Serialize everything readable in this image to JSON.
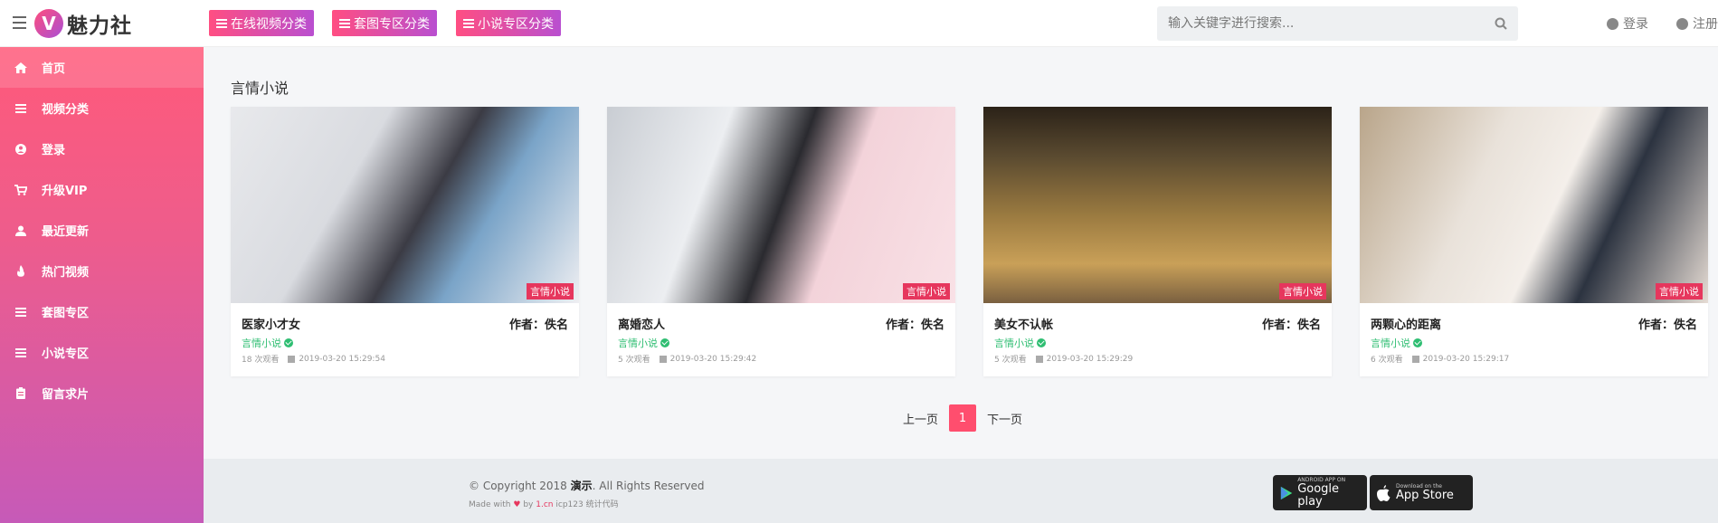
{
  "header": {
    "logo_letter": "V",
    "logo_text": "魅力社",
    "categories": [
      {
        "label": "在线视频分类"
      },
      {
        "label": "套图专区分类"
      },
      {
        "label": "小说专区分类"
      }
    ],
    "search_placeholder": "输入关键字进行搜索...",
    "login_label": "登录",
    "register_label": "注册"
  },
  "sidebar": {
    "items": [
      {
        "label": "首页",
        "icon": "home-icon"
      },
      {
        "label": "视频分类",
        "icon": "list-icon"
      },
      {
        "label": "登录",
        "icon": "user-circle-icon"
      },
      {
        "label": "升级VIP",
        "icon": "cart-icon"
      },
      {
        "label": "最近更新",
        "icon": "user-icon"
      },
      {
        "label": "热门视频",
        "icon": "fire-icon"
      },
      {
        "label": "套图专区",
        "icon": "list-icon"
      },
      {
        "label": "小说专区",
        "icon": "list-icon"
      },
      {
        "label": "留言求片",
        "icon": "clipboard-icon"
      }
    ]
  },
  "section": {
    "title": "言情小说"
  },
  "cards": [
    {
      "title": "医家小才女",
      "author": "作者：佚名",
      "category": "言情小说",
      "tag": "言情小说",
      "views": "18 次观看",
      "date": "2019-03-20 15:29:54"
    },
    {
      "title": "离婚恋人",
      "author": "作者：佚名",
      "category": "言情小说",
      "tag": "言情小说",
      "views": "5 次观看",
      "date": "2019-03-20 15:29:42"
    },
    {
      "title": "美女不认帐",
      "author": "作者：佚名",
      "category": "言情小说",
      "tag": "言情小说",
      "views": "5 次观看",
      "date": "2019-03-20 15:29:29"
    },
    {
      "title": "两颗心的距离",
      "author": "作者：佚名",
      "category": "言情小说",
      "tag": "言情小说",
      "views": "6 次观看",
      "date": "2019-03-20 15:29:17"
    }
  ],
  "pagination": {
    "prev": "上一页",
    "current": "1",
    "next": "下一页"
  },
  "footer": {
    "copyright_prefix": "© Copyright 2018",
    "copyright_site": "演示",
    "copyright_suffix": ". All Rights Reserved",
    "made_with": "Made with",
    "by": "by",
    "link": "1.cn",
    "icp": "icp123",
    "stats": "统计代码",
    "google_small": "ANDROID APP ON",
    "google_big": "Google play",
    "apple_small": "Download on the",
    "apple_big": "App Store"
  },
  "colors": {
    "accent_start": "#ff4e82",
    "accent_end": "#b94fd0",
    "tag": "#e6365d",
    "verified": "#2fbe72"
  }
}
